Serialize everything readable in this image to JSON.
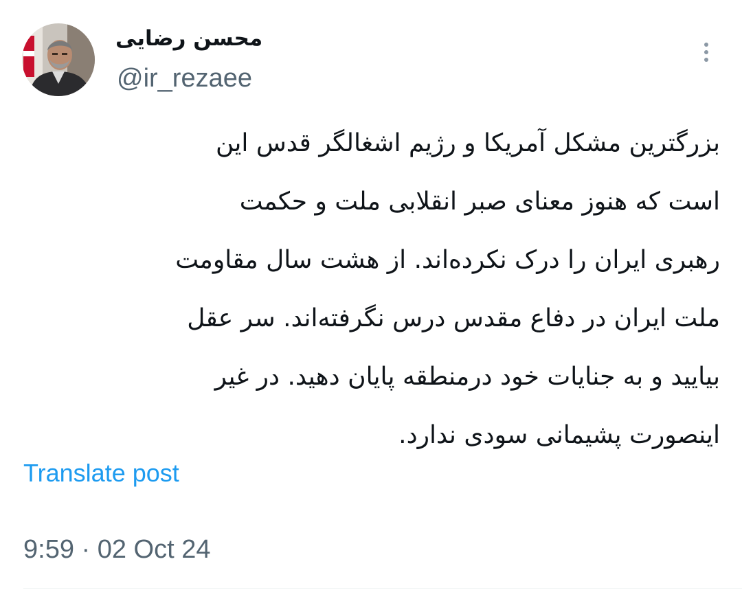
{
  "author": {
    "display_name": "محسن رضایی",
    "handle": "@ir_rezaee"
  },
  "post": {
    "lines": [
      "بزرگترین مشکل آمریکا و رژیم اشغالگر قدس این",
      "است که هنوز معنای صبر انقلابی ملت و حکمت",
      "رهبری ایران را درک نکرده‌اند. از هشت سال مقاومت",
      "ملت ایران در دفاع مقدس درس نگرفته‌اند. سر عقل",
      "بیایید و به جنایات خود درمنطقه پایان دهید. در غیر",
      "اینصورت پشیمانی سودی ندارد."
    ],
    "translate_label": "Translate post",
    "timestamp": "9:59 · 02 Oct 24"
  },
  "icons": {
    "more": "more-vertical-icon",
    "avatar": "profile-photo"
  },
  "colors": {
    "text": "#0f1419",
    "secondary": "#536471",
    "link": "#1d9bf0",
    "more_dots": "#8b98a5"
  }
}
